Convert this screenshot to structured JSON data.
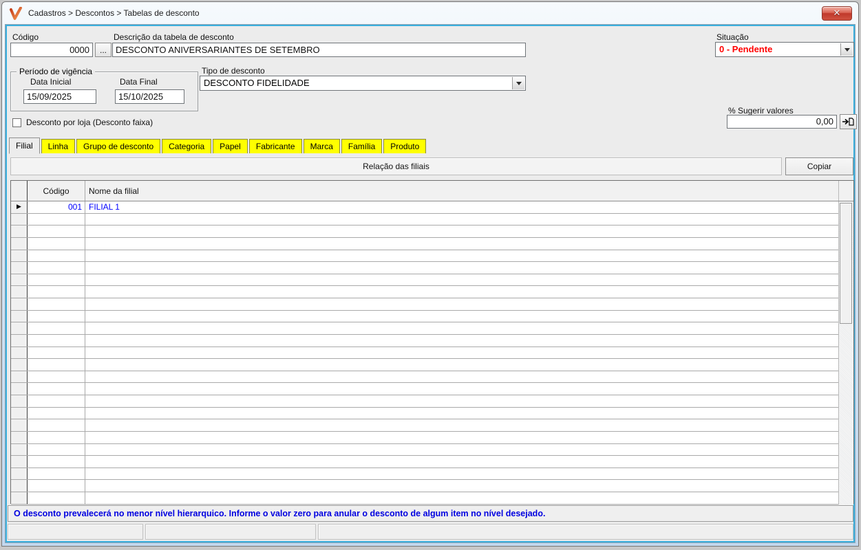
{
  "colors": {
    "accent_border": "#3AAFDD",
    "tab_yellow": "#FFFF00",
    "situacao_red": "#FF0000",
    "grid_blue": "#0000FF",
    "message_blue": "#0000E0"
  },
  "window": {
    "title": "Cadastros > Descontos > Tabelas de desconto"
  },
  "form": {
    "codigo": {
      "label": "Código",
      "value": "0000"
    },
    "browse_button": "...",
    "descricao": {
      "label": "Descrição da tabela de desconto",
      "value": "DESCONTO ANIVERSARIANTES DE SETEMBRO"
    },
    "situacao": {
      "label": "Situação",
      "value": "0 - Pendente"
    },
    "periodo": {
      "legend": "Período de vigência",
      "data_inicial_label": "Data Inicial",
      "data_inicial_value": "15/09/2025",
      "data_final_label": "Data Final",
      "data_final_value": "15/10/2025"
    },
    "tipo_desconto": {
      "label": "Tipo de desconto",
      "value": "DESCONTO FIDELIDADE"
    },
    "sugerir": {
      "label": "% Sugerir valores",
      "value": "0,00"
    },
    "desconto_por_loja": {
      "label": "Desconto por loja (Desconto faixa)",
      "checked": false
    }
  },
  "tabs": {
    "active_index": 0,
    "items": [
      "Filial",
      "Linha",
      "Grupo de desconto",
      "Categoria",
      "Papel",
      "Fabricante",
      "Marca",
      "Família",
      "Produto"
    ]
  },
  "panel": {
    "title": "Relação das filiais",
    "copy_button": "Copiar"
  },
  "grid": {
    "columns": [
      "Código",
      "Nome da filial"
    ],
    "rows": [
      {
        "codigo": "001",
        "nome": "FILIAL 1"
      }
    ],
    "empty_rows": 24
  },
  "footer": {
    "message": "O desconto prevalecerá no menor nível hierarquico. Informe o valor zero para anular o desconto de algum item no nível desejado."
  },
  "statusbar": {
    "panels": [
      "",
      "",
      ""
    ]
  }
}
